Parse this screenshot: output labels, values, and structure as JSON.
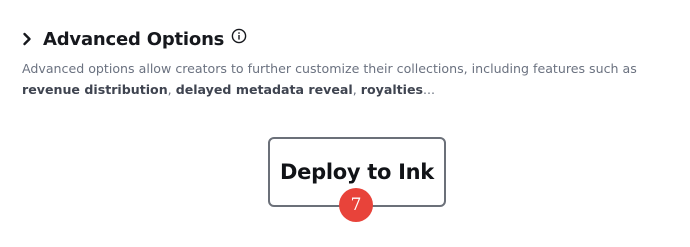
{
  "advanced_options": {
    "title": "Advanced Options",
    "expand_icon": "chevron-right-icon",
    "info_icon": "info-circle-icon",
    "description": {
      "line1": "Advanced options allow creators to further customize their collections, including features such as",
      "highlight1": "revenue distribution",
      "sep1": ", ",
      "highlight2": "delayed metadata reveal",
      "sep2": ", ",
      "highlight3": "royalties",
      "suffix": "..."
    }
  },
  "deploy": {
    "label": "Deploy to Ink",
    "step_badge": "7"
  },
  "colors": {
    "badge": "#e8433a",
    "title": "#16181d",
    "description": "#6b7280",
    "button_border": "#6b7079"
  }
}
